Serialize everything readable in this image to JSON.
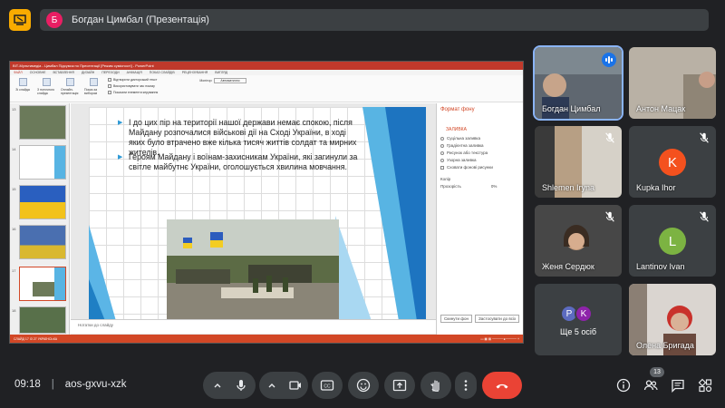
{
  "header": {
    "presenter_initial": "Б",
    "presenter_label": "Богдан Цимбал (Презентація)"
  },
  "presentation": {
    "window_title": "ВІТ-Мультимедіа - Цимбал Підсумок по Пресентації [Режим сумісності] - PowerPoint",
    "tabs": [
      "ФАЙЛ",
      "ОСНОВНЕ",
      "ВСТАВЛЕННЯ",
      "ДИЗАЙН",
      "ПЕРЕХОДИ",
      "АНІМАЦІЯ",
      "ПОКАЗ СЛАЙДІВ",
      "РЕЦЕНЗУВАННЯ",
      "ВИГЛЯД"
    ],
    "ribbon": {
      "buttons": [
        "Зі слайда",
        "З поточного слайда",
        "Онлайн-презентація",
        "Показ за вибором"
      ],
      "group_items": [
        "Відтворити дикторський текст",
        "Використовувати час показу",
        "Показати елементи керування"
      ],
      "monitor_label": "Монітор:",
      "monitor_value": "Автоматично"
    },
    "thumb_numbers": [
      "13",
      "14",
      "15",
      "16",
      "17",
      "18"
    ],
    "slide": {
      "bullet1": "І до цих пір на території нашої держави немає спокою, після Майдану розпочалися військові дії на Сході України, в ході яких було втрачено вже кілька тисяч життів солдат та мирних жителів.",
      "bullet2": "Героям Майдану і воїнам-захисникам України, які загинули за світле майбутнє України, оголошується хвилина мовчання."
    },
    "notes_placeholder": "Нотатки до слайду",
    "format_pane": {
      "title": "Формат фону",
      "section": "ЗАЛИВКА",
      "options": [
        "Суцільна заливка",
        "Градієнтна заливка",
        "Рисунок або текстура",
        "Узорна заливка",
        "Сховати фонові рисунки"
      ],
      "color_label": "Колір",
      "transparency_label": "Прозорість",
      "transparency_value": "0%",
      "reset_button": "Скинути фон",
      "apply_all_button": "Застосувати до всіх"
    },
    "status_bar": "СЛАЙД 17 ІЗ 27   УКРАЇНСЬКА"
  },
  "participants": [
    {
      "name": "Богдан Цимбал",
      "speaking": true
    },
    {
      "name": "Антон Мацак"
    },
    {
      "name": "Shlemen Iryna",
      "muted": true
    },
    {
      "name": "Kupka Ihor",
      "initial": "K",
      "color": "#f4511e",
      "muted": true
    },
    {
      "name": "Женя Сердюк",
      "muted": true
    },
    {
      "name": "Lantinov Ivan",
      "initial": "L",
      "color": "#7cb342",
      "muted": true
    },
    {
      "more_label": "Ще 5 осіб",
      "initials": [
        "P",
        "K"
      ],
      "colors": [
        "#5c6bc0",
        "#8e24aa"
      ]
    },
    {
      "name": "Олена Бригада"
    }
  ],
  "bottom": {
    "time": "09:18",
    "meeting_code": "aos-gxvu-xzk",
    "participant_count": "13"
  },
  "colors": {
    "background": "#202124",
    "tile": "#3c4043",
    "accent": "#1a73e8",
    "end_call": "#ea4335",
    "ppt_red": "#d24726"
  }
}
